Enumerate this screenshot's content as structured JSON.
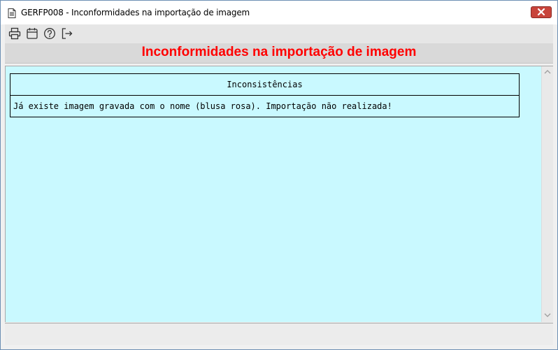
{
  "window": {
    "title": "GERFP008 - Inconformidades na importação de imagem"
  },
  "toolbar": {
    "buttons": [
      {
        "icon": "printer-icon"
      },
      {
        "icon": "calendar-icon"
      },
      {
        "icon": "help-icon"
      },
      {
        "icon": "exit-icon"
      }
    ]
  },
  "header": {
    "title": "Inconformidades na importação de imagem",
    "title_color": "#ff0000"
  },
  "content": {
    "background": "#c9f9ff",
    "table": {
      "columns": [
        "Inconsistências"
      ],
      "rows": [
        [
          "Já existe imagem gravada com o nome (blusa rosa). Importação não realizada!"
        ]
      ]
    }
  }
}
